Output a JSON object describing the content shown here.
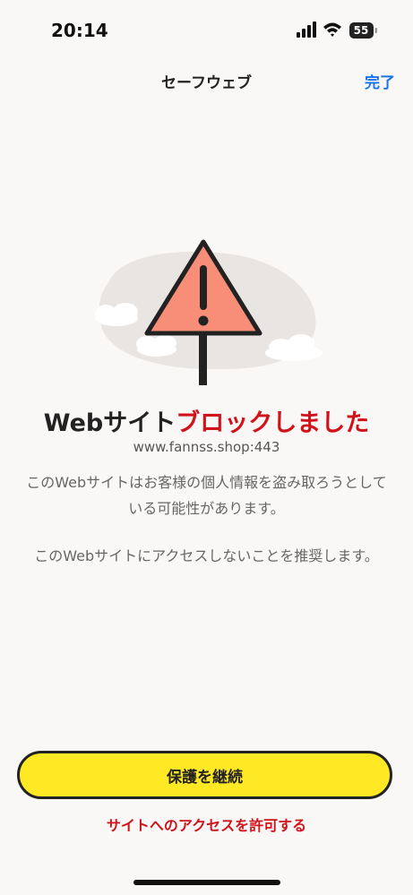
{
  "status_bar": {
    "time": "20:14",
    "battery_level": "55",
    "icons": [
      "signal-icon",
      "wifi-icon",
      "battery-icon"
    ]
  },
  "nav": {
    "title": "セーフウェブ",
    "done_label": "完了"
  },
  "warning": {
    "icon": "warning-sign-icon",
    "heading_prefix": "Webサイト",
    "heading_blocked": "ブロックしました",
    "url": "www.fannss.shop:443",
    "message_1": "このWebサイトはお客様の個人情報を盗み取ろうとしている可能性があります。",
    "message_2": "このWebサイトにアクセスしないことを推奨します。"
  },
  "actions": {
    "continue_label": "保護を継続",
    "allow_label": "サイトへのアクセスを許可する"
  },
  "colors": {
    "accent_blue": "#1a73e8",
    "danger_red": "#d0121b",
    "button_yellow": "#ffe924",
    "warning_orange": "#f88d78"
  }
}
